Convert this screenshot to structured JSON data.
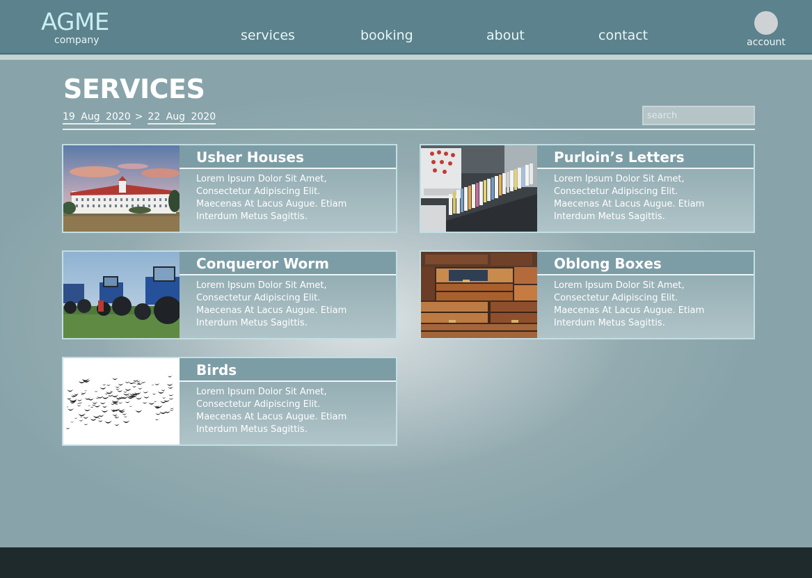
{
  "header": {
    "logo_title": "AGME",
    "logo_sub": "company",
    "nav": [
      "services",
      "booking",
      "about",
      "contact"
    ],
    "account_label": "account"
  },
  "page": {
    "title": "SERVICES",
    "date_from": "19 Aug 2020",
    "date_sep": ">",
    "date_to": "22 Aug 2020",
    "search_placeholder": "search"
  },
  "services": [
    {
      "title": "Usher Houses",
      "desc": [
        "Lorem Ipsum Dolor Sit Amet,",
        "Consectetur Adipiscing Elit.",
        "Maecenas At Lacus Augue. Etiam",
        "Interdum Metus Sagittis."
      ]
    },
    {
      "title": "Purloin’s Letters",
      "desc": [
        "Lorem Ipsum Dolor Sit Amet,",
        "Consectetur Adipiscing Elit.",
        "Maecenas At Lacus Augue. Etiam",
        "Interdum Metus Sagittis."
      ]
    },
    {
      "title": "Conqueror Worm",
      "desc": [
        "Lorem Ipsum Dolor Sit Amet,",
        "Consectetur Adipiscing Elit.",
        "Maecenas At Lacus Augue. Etiam",
        "Interdum Metus Sagittis."
      ]
    },
    {
      "title": "Oblong Boxes",
      "desc": [
        "Lorem Ipsum Dolor Sit Amet,",
        "Consectetur Adipiscing Elit.",
        "Maecenas At Lacus Augue. Etiam",
        "Interdum Metus Sagittis."
      ]
    },
    {
      "title": "Birds",
      "desc": [
        "Lorem Ipsum Dolor Sit Amet,",
        "Consectetur Adipiscing Elit.",
        "Maecenas At Lacus Augue. Etiam",
        "Interdum Metus Sagittis."
      ]
    }
  ],
  "colors": {
    "header_bg": "#5b828d",
    "logo_text": "#cbeef0",
    "card_border": "#c2dfe4",
    "footer_bg": "#1f2a2d"
  }
}
